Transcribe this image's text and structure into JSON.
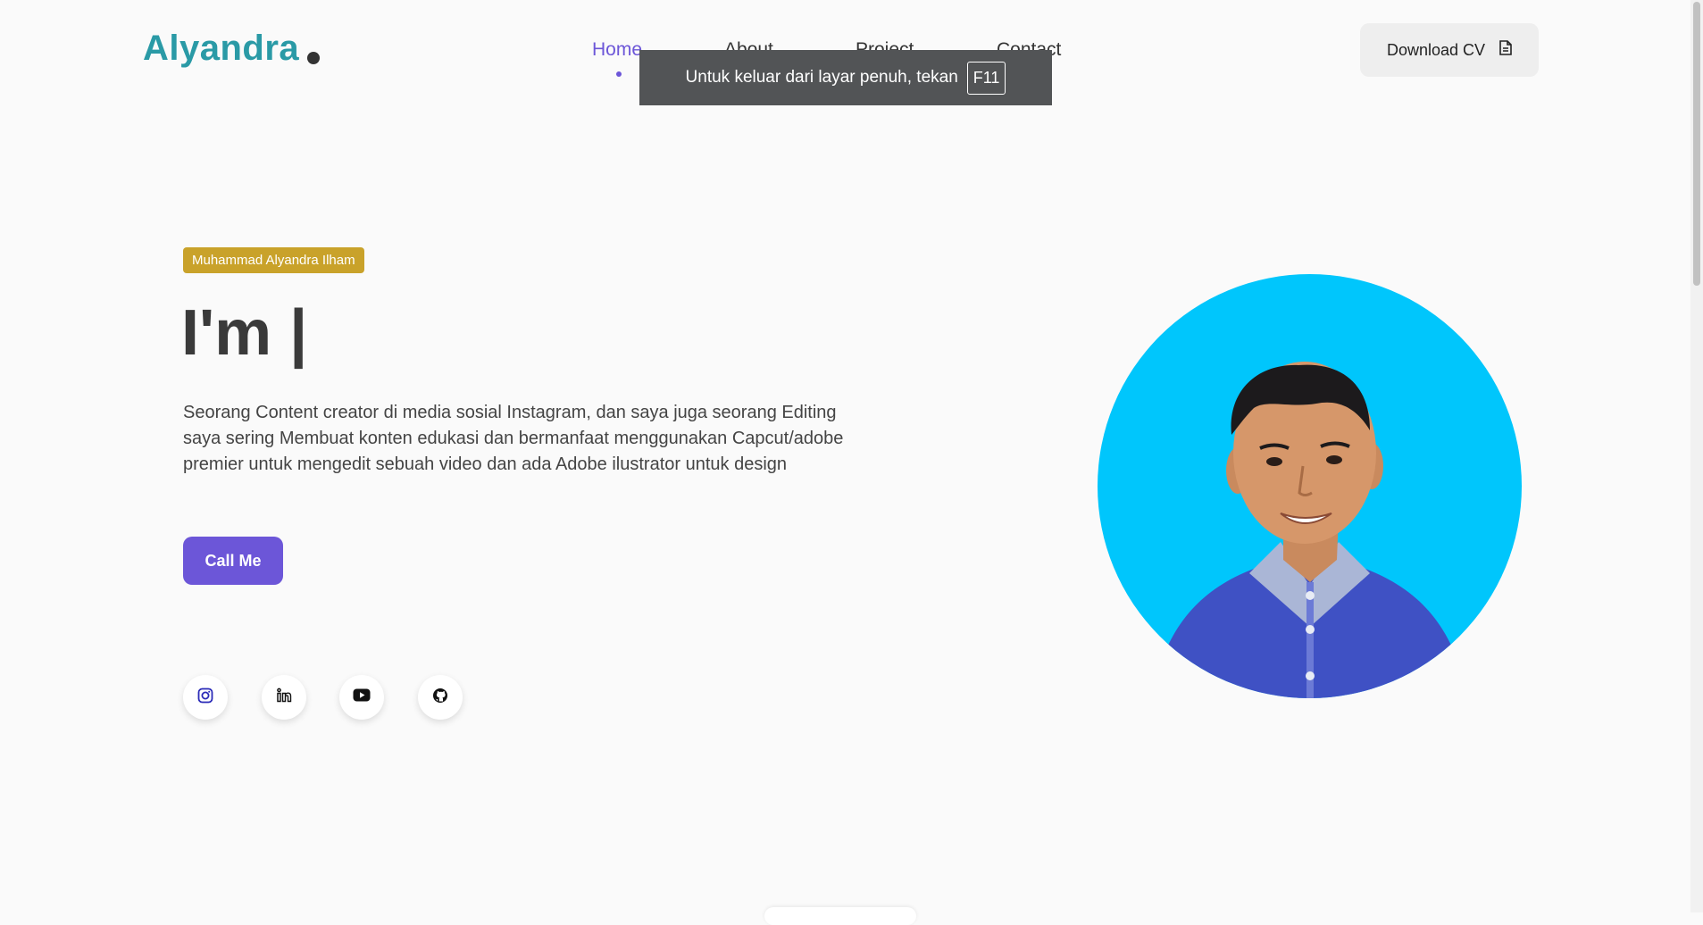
{
  "header": {
    "logo": "Alyandra",
    "nav": [
      {
        "label": "Home",
        "active": true
      },
      {
        "label": "About",
        "active": false
      },
      {
        "label": "Project",
        "active": false
      },
      {
        "label": "Contact",
        "active": false
      }
    ],
    "download_label": "Download CV",
    "download_icon": "file-icon"
  },
  "fullscreen_notice": {
    "text": "Untuk keluar dari layar penuh, tekan",
    "key": "F11"
  },
  "hero": {
    "badge": "Muhammad Alyandra Ilham",
    "headline": "I'm |",
    "bio": "Seorang Content creator di media sosial Instagram, dan saya juga seorang Editing saya sering Membuat konten edukasi dan bermanfaat menggunakan Capcut/adobe premier untuk mengedit sebuah video dan ada Adobe ilustrator untuk design",
    "cta_label": "Call Me"
  },
  "socials": [
    {
      "name": "instagram-icon"
    },
    {
      "name": "linkedin-icon"
    },
    {
      "name": "youtube-icon"
    },
    {
      "name": "github-icon"
    }
  ],
  "colors": {
    "accent": "#6c56d8",
    "logo": "#2a9aa6",
    "badge": "#c9a22a",
    "avatar_bg": "#00c6fc"
  }
}
